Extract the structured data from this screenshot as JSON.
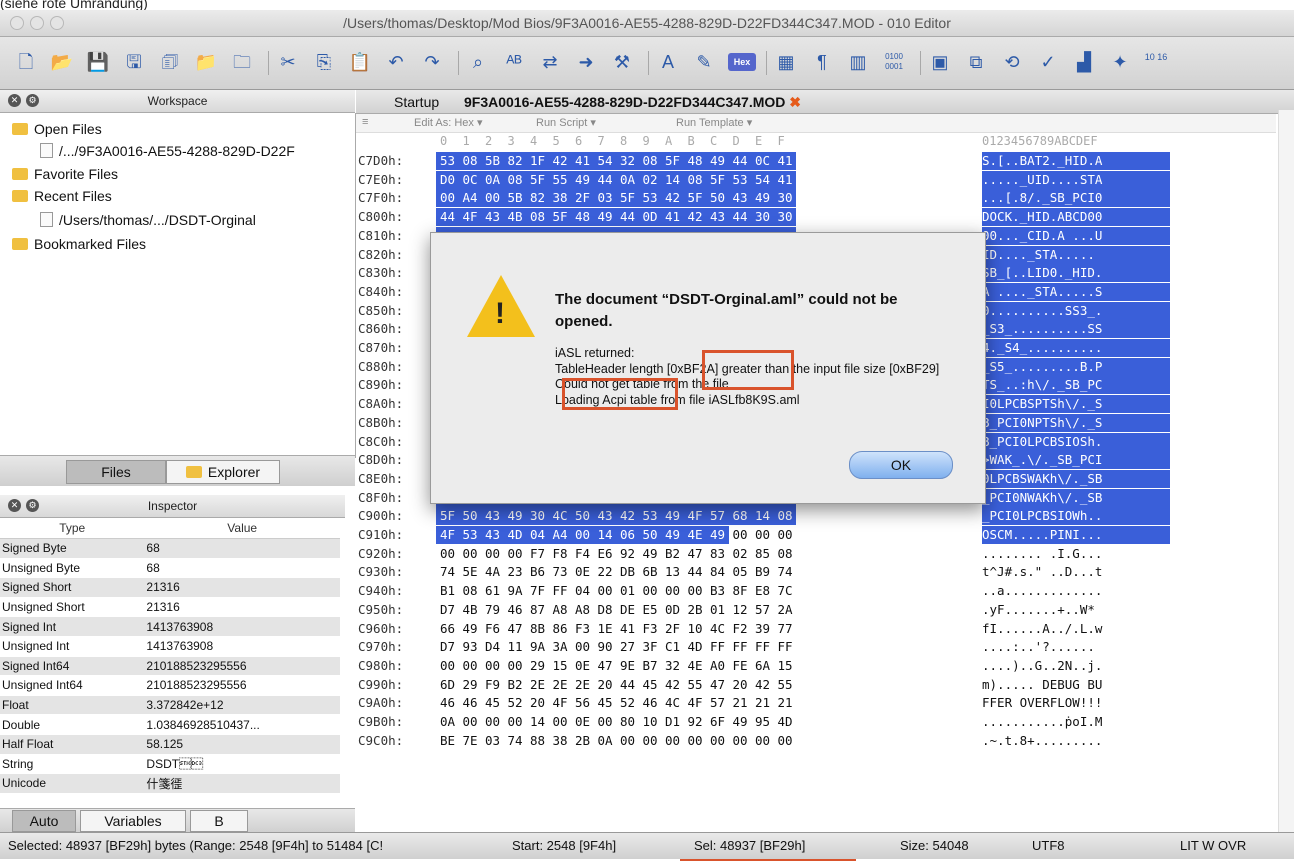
{
  "caption": "(siehe rote Umrandung)",
  "window": {
    "title": "/Users/thomas/Desktop/Mod Bios/9F3A0016-AE55-4288-829D-D22FD344C347.MOD - 010 Editor"
  },
  "toolbar": {
    "icons": [
      "new-file-icon",
      "open-file-icon",
      "save-icon",
      "save-as-icon",
      "save-all-icon",
      "open-folder-icon",
      "close-icon",
      "cut-icon",
      "copy-icon",
      "paste-icon",
      "undo-icon",
      "redo-icon",
      "find-icon",
      "spell-icon",
      "replace-icon",
      "goto-icon",
      "script-icon",
      "font-icon",
      "highlight-icon",
      "hex-icon",
      "columns-icon",
      "paragraph-icon",
      "split-icon",
      "binary-icon",
      "calculator-icon",
      "compare-icon",
      "sync-icon",
      "checksum-icon",
      "histogram-icon",
      "tools-icon",
      "base-convert-icon"
    ],
    "hex_label": "Hex",
    "binary_label": "0100 0001",
    "base_label": "10 16"
  },
  "workspace": {
    "header": "Workspace",
    "items": [
      {
        "label": "Open Files",
        "icon": "folder-icon"
      },
      {
        "label": "/.../9F3A0016-AE55-4288-829D-D22F",
        "icon": "file-icon"
      },
      {
        "label": "Favorite Files",
        "icon": "favorite-folder-icon"
      },
      {
        "label": "Recent Files",
        "icon": "recent-folder-icon"
      },
      {
        "label": "/Users/thomas/.../DSDT-Orginal",
        "icon": "file-icon"
      },
      {
        "label": "Bookmarked Files",
        "icon": "bookmark-folder-icon"
      }
    ],
    "tabs": [
      "Files",
      "Explorer"
    ]
  },
  "inspector": {
    "header": "Inspector",
    "columns": [
      "Type",
      "Value"
    ],
    "rows": [
      [
        "Signed Byte",
        "68"
      ],
      [
        "Unsigned Byte",
        "68"
      ],
      [
        "Signed Short",
        "21316"
      ],
      [
        "Unsigned Short",
        "21316"
      ],
      [
        "Signed Int",
        "1413763908"
      ],
      [
        "Unsigned Int",
        "1413763908"
      ],
      [
        "Signed Int64",
        "210188523295556"
      ],
      [
        "Unsigned Int64",
        "210188523295556"
      ],
      [
        "Float",
        "3.372842e+12"
      ],
      [
        "Double",
        "1.03846928510437..."
      ],
      [
        "Half Float",
        "58.125"
      ],
      [
        "String",
        "DSDT\u0002\u0013"
      ],
      [
        "Unicode",
        "什箋徰"
      ]
    ],
    "tabs": [
      "Auto",
      "Variables",
      "B"
    ]
  },
  "editor": {
    "tabs": [
      "Startup",
      "9F3A0016-AE55-4288-829D-D22FD344C347.MOD"
    ],
    "edit_as": "Edit As: Hex ▾",
    "run_script": "Run Script ▾",
    "run_template": "Run Template ▾",
    "col_header": [
      "0",
      "1",
      "2",
      "3",
      "4",
      "5",
      "6",
      "7",
      "8",
      "9",
      "A",
      "B",
      "C",
      "D",
      "E",
      "F"
    ],
    "ascii_header": "0123456789ABCDEF",
    "rows": [
      {
        "a": "C7D0h:",
        "b": [
          "53",
          "08",
          "5B",
          "82",
          "1F",
          "42",
          "41",
          "54",
          "32",
          "08",
          "5F",
          "48",
          "49",
          "44",
          "0C",
          "41"
        ],
        "t": "S.[..BAT2._HID.A",
        "s": [
          0,
          16
        ]
      },
      {
        "a": "C7E0h:",
        "b": [
          "D0",
          "0C",
          "0A",
          "08",
          "5F",
          "55",
          "49",
          "44",
          "0A",
          "02",
          "14",
          "08",
          "5F",
          "53",
          "54",
          "41"
        ],
        "t": "....._UID....STA",
        "s": [
          0,
          16
        ]
      },
      {
        "a": "C7F0h:",
        "b": [
          "00",
          "A4",
          "00",
          "5B",
          "82",
          "38",
          "2F",
          "03",
          "5F",
          "53",
          "42",
          "5F",
          "50",
          "43",
          "49",
          "30"
        ],
        "t": "...[.8/._SB_PCI0",
        "s": [
          0,
          16
        ]
      },
      {
        "a": "C800h:",
        "b": [
          "44",
          "4F",
          "43",
          "4B",
          "08",
          "5F",
          "48",
          "49",
          "44",
          "0D",
          "41",
          "42",
          "43",
          "44",
          "30",
          "30"
        ],
        "t": "DOCK._HID.ABCD00",
        "s": [
          0,
          16
        ]
      },
      {
        "a": "C810h:",
        "b": [],
        "t": "00..._CID.A ...U",
        "s": [
          0,
          16
        ]
      },
      {
        "a": "C820h:",
        "b": [],
        "t": "ID...._STA.....",
        "s": [
          0,
          16
        ]
      },
      {
        "a": "C830h:",
        "b": [],
        "t": "SB_[..LID0._HID.",
        "s": [
          0,
          16
        ]
      },
      {
        "a": "C840h:",
        "b": [],
        "t": "A ...._STA.....S",
        "s": [
          0,
          16
        ]
      },
      {
        "a": "C850h:",
        "b": [],
        "t": "0..........SS3_.",
        "s": [
          0,
          16
        ]
      },
      {
        "a": "C860h:",
        "b": [],
        "t": "_S3_..........SS",
        "s": [
          0,
          16
        ]
      },
      {
        "a": "C870h:",
        "b": [],
        "t": "4._S4_..........",
        "s": [
          0,
          16
        ]
      },
      {
        "a": "C880h:",
        "b": [],
        "t": "_S5_.........B.P",
        "s": [
          0,
          16
        ]
      },
      {
        "a": "C890h:",
        "b": [],
        "t": "TS_..:h\\/._SB_PC",
        "s": [
          0,
          16
        ]
      },
      {
        "a": "C8A0h:",
        "b": [],
        "t": "I0LPCBSPTSh\\/._S",
        "s": [
          0,
          16
        ]
      },
      {
        "a": "C8B0h:",
        "b": [],
        "t": "B_PCI0NPTSh\\/._S",
        "s": [
          0,
          16
        ]
      },
      {
        "a": "C8C0h:",
        "b": [],
        "t": "B_PCI0LPCBSIOSh.",
        "s": [
          0,
          16
        ]
      },
      {
        "a": "C8D0h:",
        "b": [
          "3E",
          "57",
          "41",
          "4B",
          "5F",
          "01",
          "5C",
          "2F",
          "04",
          "5F",
          "53",
          "42",
          "5F",
          "50",
          "43",
          "49"
        ],
        "t": ">WAK_.\\/._SB_PCI",
        "s": [
          0,
          16
        ]
      },
      {
        "a": "C8E0h:",
        "b": [
          "30",
          "4C",
          "50",
          "43",
          "42",
          "53",
          "57",
          "41",
          "4B",
          "68",
          "5C",
          "2F",
          "03",
          "5F",
          "53",
          "42"
        ],
        "t": "0LPCBSWAKh\\/._SB",
        "s": [
          0,
          16
        ]
      },
      {
        "a": "C8F0h:",
        "b": [
          "5F",
          "50",
          "43",
          "49",
          "30",
          "4E",
          "57",
          "41",
          "4B",
          "68",
          "5C",
          "2F",
          "04",
          "5F",
          "53",
          "42"
        ],
        "t": "_PCI0NWAKh\\/._SB",
        "s": [
          0,
          16
        ]
      },
      {
        "a": "C900h:",
        "b": [
          "5F",
          "50",
          "43",
          "49",
          "30",
          "4C",
          "50",
          "43",
          "42",
          "53",
          "49",
          "4F",
          "57",
          "68",
          "14",
          "08"
        ],
        "t": "_PCI0LPCBSIOWh..",
        "s": [
          0,
          16
        ]
      },
      {
        "a": "C910h:",
        "b": [
          "4F",
          "53",
          "43",
          "4D",
          "04",
          "A4",
          "00",
          "14",
          "06",
          "50",
          "49",
          "4E",
          "49",
          "00",
          "00",
          "00"
        ],
        "t": "OSCM.....PINI...",
        "s": [
          0,
          13
        ]
      },
      {
        "a": "C920h:",
        "b": [
          "00",
          "00",
          "00",
          "00",
          "F7",
          "F8",
          "F4",
          "E6",
          "92",
          "49",
          "B2",
          "47",
          "83",
          "02",
          "85",
          "08"
        ],
        "t": "........ .I.G...",
        "s": [
          0,
          0
        ]
      },
      {
        "a": "C930h:",
        "b": [
          "74",
          "5E",
          "4A",
          "23",
          "B6",
          "73",
          "0E",
          "22",
          "DB",
          "6B",
          "13",
          "44",
          "84",
          "05",
          "B9",
          "74"
        ],
        "t": "t^J#.s.\" ..D...t",
        "s": [
          0,
          0
        ]
      },
      {
        "a": "C940h:",
        "b": [
          "B1",
          "08",
          "61",
          "9A",
          "7F",
          "FF",
          "04",
          "00",
          "01",
          "00",
          "00",
          "00",
          "B3",
          "8F",
          "E8",
          "7C"
        ],
        "t": "..a.............",
        "s": [
          0,
          0
        ]
      },
      {
        "a": "C950h:",
        "b": [
          "D7",
          "4B",
          "79",
          "46",
          "87",
          "A8",
          "A8",
          "D8",
          "DE",
          "E5",
          "0D",
          "2B",
          "01",
          "12",
          "57",
          "2A"
        ],
        "t": ".yF.......+..W*",
        "s": [
          0,
          0
        ]
      },
      {
        "a": "C960h:",
        "b": [
          "66",
          "49",
          "F6",
          "47",
          "8B",
          "86",
          "F3",
          "1E",
          "41",
          "F3",
          "2F",
          "10",
          "4C",
          "F2",
          "39",
          "77"
        ],
        "t": "fI......A../.L.w",
        "s": [
          0,
          0
        ]
      },
      {
        "a": "C970h:",
        "b": [
          "D7",
          "93",
          "D4",
          "11",
          "9A",
          "3A",
          "00",
          "90",
          "27",
          "3F",
          "C1",
          "4D",
          "FF",
          "FF",
          "FF",
          "FF"
        ],
        "t": "....:..'?......",
        "s": [
          0,
          0
        ]
      },
      {
        "a": "C980h:",
        "b": [
          "00",
          "00",
          "00",
          "00",
          "29",
          "15",
          "0E",
          "47",
          "9E",
          "B7",
          "32",
          "4E",
          "A0",
          "FE",
          "6A",
          "15"
        ],
        "t": "....)..G..2N..j.",
        "s": [
          0,
          0
        ]
      },
      {
        "a": "C990h:",
        "b": [
          "6D",
          "29",
          "F9",
          "B2",
          "2E",
          "2E",
          "2E",
          "20",
          "44",
          "45",
          "42",
          "55",
          "47",
          "20",
          "42",
          "55"
        ],
        "t": "m)..... DEBUG BU",
        "s": [
          0,
          0
        ]
      },
      {
        "a": "C9A0h:",
        "b": [
          "46",
          "46",
          "45",
          "52",
          "20",
          "4F",
          "56",
          "45",
          "52",
          "46",
          "4C",
          "4F",
          "57",
          "21",
          "21",
          "21"
        ],
        "t": "FFER OVERFLOW!!!",
        "s": [
          0,
          0
        ]
      },
      {
        "a": "C9B0h:",
        "b": [
          "0A",
          "00",
          "00",
          "00",
          "14",
          "00",
          "0E",
          "00",
          "80",
          "10",
          "D1",
          "92",
          "6F",
          "49",
          "95",
          "4D"
        ],
        "t": "...........ṗoI.M",
        "s": [
          0,
          0
        ]
      },
      {
        "a": "C9C0h:",
        "b": [
          "BE",
          "7E",
          "03",
          "74",
          "88",
          "38",
          "2B",
          "0A",
          "00",
          "00",
          "00",
          "00",
          "00",
          "00",
          "00",
          "00"
        ],
        "t": ".~.t.8+.........",
        "s": [
          0,
          0
        ]
      }
    ]
  },
  "dialog": {
    "title": "The document “DSDT-Orginal.aml” could not be opened.",
    "line1": "iASL returned:",
    "line2": "TableHeader length [0xBF2A] greater than the input file size [0xBF29]",
    "line3": "Could not get table from the file",
    "line4": "Loading Acpi table from file iASLfb8K9S.aml",
    "ok": "OK"
  },
  "status": {
    "selected": "Selected: 48937 [BF29h] bytes (Range: 2548 [9F4h] to 51484 [C!",
    "start": "Start: 2548 [9F4h]",
    "sel": "Sel: 48937 [BF29h]",
    "size": "Size: 54048",
    "encoding": "UTF8",
    "modes": "LIT  W  OVR"
  },
  "colors": {
    "selection": "#3a5fd9",
    "highlight_box": "#d9532c",
    "ok_button": "#7fb0ee"
  }
}
